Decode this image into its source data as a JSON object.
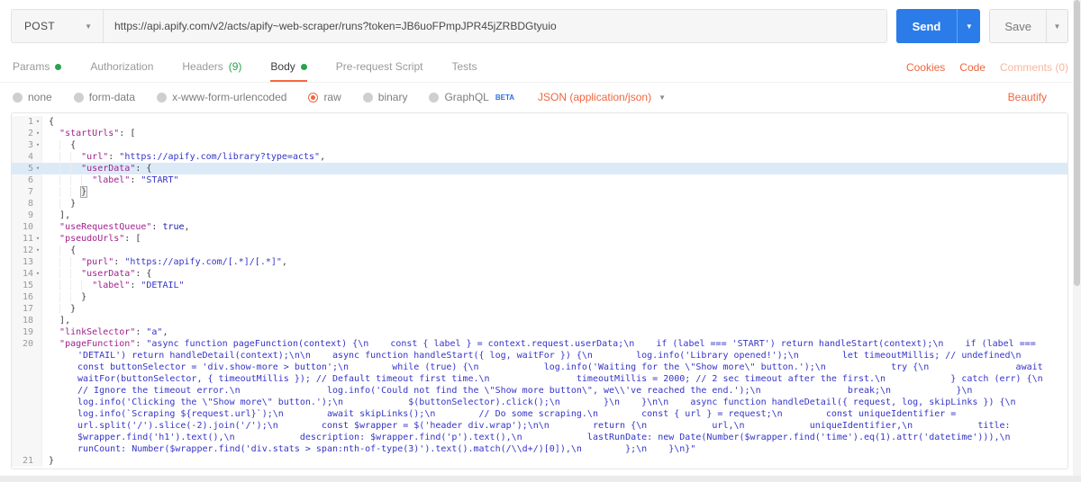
{
  "request_bar": {
    "method": "POST",
    "url": "https://api.apify.com/v2/acts/apify~web-scraper/runs?token=JB6uoFPmpJPR45jZRBDGtyuio",
    "send_label": "Send",
    "save_label": "Save"
  },
  "tabs": {
    "items": [
      {
        "label": "Params",
        "dot": true
      },
      {
        "label": "Authorization"
      },
      {
        "label": "Headers",
        "suffix": "(9)"
      },
      {
        "label": "Body",
        "dot": true,
        "active": true
      },
      {
        "label": "Pre-request Script"
      },
      {
        "label": "Tests"
      }
    ],
    "right_links": [
      {
        "label": "Cookies"
      },
      {
        "label": "Code"
      },
      {
        "label": "Comments (0)",
        "muted": true
      }
    ]
  },
  "body_type_bar": {
    "options": [
      {
        "label": "none"
      },
      {
        "label": "form-data"
      },
      {
        "label": "x-www-form-urlencoded"
      },
      {
        "label": "raw",
        "selected": true
      },
      {
        "label": "binary"
      },
      {
        "label": "GraphQL",
        "beta": "BETA"
      }
    ],
    "selected": "raw",
    "content_type": "JSON (application/json)",
    "beautify_label": "Beautify"
  },
  "colors": {
    "accent_orange": "#F0663F",
    "send_blue": "#2B7CE9",
    "green": "#2BA24C",
    "beta_blue": "#2D6EE0",
    "json_key": "#A0218C",
    "json_string": "#3434C8",
    "json_atom": "#1A1AA8",
    "active_line_highlight": "#DCEAF8"
  },
  "editor": {
    "lines": [
      {
        "n": 1,
        "fold": true,
        "tokens": [
          [
            "p",
            "{"
          ]
        ]
      },
      {
        "n": 2,
        "fold": true,
        "tokens": [
          [
            "w"
          ],
          [
            "k",
            "\"startUrls\""
          ],
          [
            "p",
            ": ["
          ]
        ]
      },
      {
        "n": 3,
        "fold": true,
        "tokens": [
          [
            "w"
          ],
          [
            "g"
          ],
          [
            "p",
            "{"
          ]
        ]
      },
      {
        "n": 4,
        "tokens": [
          [
            "w"
          ],
          [
            "g"
          ],
          [
            "g"
          ],
          [
            "k",
            "\"url\""
          ],
          [
            "p",
            ": "
          ],
          [
            "s",
            "\"https://apify.com/library?type=acts\""
          ],
          [
            "p",
            ","
          ]
        ]
      },
      {
        "n": 5,
        "fold": true,
        "hl": true,
        "tokens": [
          [
            "w"
          ],
          [
            "g"
          ],
          [
            "g"
          ],
          [
            "k",
            "\"userData\""
          ],
          [
            "p",
            ": {"
          ]
        ]
      },
      {
        "n": 6,
        "tokens": [
          [
            "w"
          ],
          [
            "g"
          ],
          [
            "g"
          ],
          [
            "g"
          ],
          [
            "k",
            "\"label\""
          ],
          [
            "p",
            ": "
          ],
          [
            "s",
            "\"START\""
          ]
        ]
      },
      {
        "n": 7,
        "tokens": [
          [
            "w"
          ],
          [
            "g"
          ],
          [
            "g"
          ],
          [
            "b",
            "}"
          ]
        ]
      },
      {
        "n": 8,
        "tokens": [
          [
            "w"
          ],
          [
            "g"
          ],
          [
            "p",
            "}"
          ]
        ]
      },
      {
        "n": 9,
        "tokens": [
          [
            "w"
          ],
          [
            "p",
            "],"
          ]
        ]
      },
      {
        "n": 10,
        "tokens": [
          [
            "w"
          ],
          [
            "k",
            "\"useRequestQueue\""
          ],
          [
            "p",
            ": "
          ],
          [
            "a",
            "true"
          ],
          [
            "p",
            ","
          ]
        ]
      },
      {
        "n": 11,
        "fold": true,
        "tokens": [
          [
            "w"
          ],
          [
            "k",
            "\"pseudoUrls\""
          ],
          [
            "p",
            ": ["
          ]
        ]
      },
      {
        "n": 12,
        "fold": true,
        "tokens": [
          [
            "w"
          ],
          [
            "g"
          ],
          [
            "p",
            "{"
          ]
        ]
      },
      {
        "n": 13,
        "tokens": [
          [
            "w"
          ],
          [
            "g"
          ],
          [
            "g"
          ],
          [
            "k",
            "\"purl\""
          ],
          [
            "p",
            ": "
          ],
          [
            "s",
            "\"https://apify.com/[.*]/[.*]\""
          ],
          [
            "p",
            ","
          ]
        ]
      },
      {
        "n": 14,
        "fold": true,
        "tokens": [
          [
            "w"
          ],
          [
            "g"
          ],
          [
            "g"
          ],
          [
            "k",
            "\"userData\""
          ],
          [
            "p",
            ": {"
          ]
        ]
      },
      {
        "n": 15,
        "tokens": [
          [
            "w"
          ],
          [
            "g"
          ],
          [
            "g"
          ],
          [
            "g"
          ],
          [
            "k",
            "\"label\""
          ],
          [
            "p",
            ": "
          ],
          [
            "s",
            "\"DETAIL\""
          ]
        ]
      },
      {
        "n": 16,
        "tokens": [
          [
            "w"
          ],
          [
            "g"
          ],
          [
            "g"
          ],
          [
            "p",
            "}"
          ]
        ]
      },
      {
        "n": 17,
        "tokens": [
          [
            "w"
          ],
          [
            "g"
          ],
          [
            "p",
            "}"
          ]
        ]
      },
      {
        "n": 18,
        "tokens": [
          [
            "w"
          ],
          [
            "p",
            "],"
          ]
        ]
      },
      {
        "n": 19,
        "tokens": [
          [
            "w"
          ],
          [
            "k",
            "\"linkSelector\""
          ],
          [
            "p",
            ": "
          ],
          [
            "s",
            "\"a\""
          ],
          [
            "p",
            ","
          ]
        ]
      },
      {
        "n": 20,
        "hang": true,
        "tokens": [
          [
            "w"
          ],
          [
            "k",
            "\"pageFunction\""
          ],
          [
            "p",
            ": "
          ],
          [
            "s",
            "\"async function pageFunction(context) {\\n    const { label } = context.request.userData;\\n    if (label === 'START') return handleStart(context);\\n    if (label === 'DETAIL') return handleDetail(context);\\n\\n    async function handleStart({ log, waitFor }) {\\n        log.info('Library opened!');\\n        let timeoutMillis; // undefined\\n        const buttonSelector = 'div.show-more > button';\\n        while (true) {\\n            log.info('Waiting for the \\\"Show more\\\" button.');\\n            try {\\n                await waitFor(buttonSelector, { timeoutMillis }); // Default timeout first time.\\n                timeoutMillis = 2000; // 2 sec timeout after the first.\\n            } catch (err) {\\n                // Ignore the timeout error.\\n                log.info('Could not find the \\\"Show more button\\\", we\\\\'ve reached the end.');\\n                break;\\n            }\\n            log.info('Clicking the \\\"Show more\\\" button.');\\n            $(buttonSelector).click();\\n        }\\n    }\\n\\n    async function handleDetail({ request, log, skipLinks }) {\\n        log.info(`Scraping ${request.url}`);\\n        await skipLinks();\\n        // Do some scraping.\\n        const { url } = request;\\n        const uniqueIdentifier = url.split('/').slice(-2).join('/');\\n        const $wrapper = $('header div.wrap');\\n\\n        return {\\n            url,\\n            uniqueIdentifier,\\n            title: $wrapper.find('h1').text(),\\n            description: $wrapper.find('p').text(),\\n            lastRunDate: new Date(Number($wrapper.find('time').eq(1).attr('datetime'))),\\n            runCount: Number($wrapper.find('div.stats > span:nth-of-type(3)').text().match(/\\\\d+/)[0]),\\n        };\\n    }\\n}\""
          ]
        ]
      },
      {
        "n": 21,
        "tokens": [
          [
            "p",
            "}"
          ]
        ]
      }
    ]
  }
}
